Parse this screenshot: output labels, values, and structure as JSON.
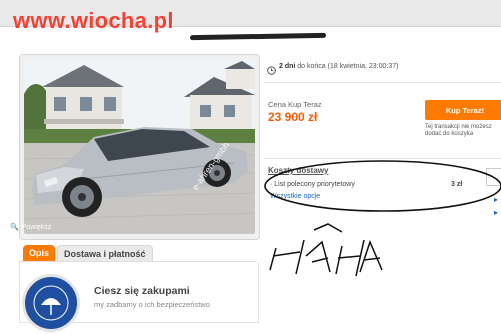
{
  "site": {
    "logo": "www.wiocha.pl"
  },
  "auction": {
    "deadline_prefix": "2 dni",
    "deadline_suffix": " do końca (18 kwietnia, 23:00:37)"
  },
  "gallery": {
    "zoom_label": "Powiększ",
    "watermark": "e-ahren-gmbh"
  },
  "price": {
    "label": "Cena Kup Teraz",
    "value": "23 900 zł",
    "buy_button": "Kup Teraz!",
    "basket_note": "Tej transakcji nie możesz dodać do koszyka"
  },
  "shipping": {
    "title": "Koszty dostawy",
    "method": "List polecony priorytetowy",
    "method_price": "3 zł",
    "all_options": "Wszystkie opcje"
  },
  "tabs": [
    {
      "label": "Opis"
    },
    {
      "label": "Dostawa i płatność"
    }
  ],
  "shop": {
    "title": "Ciesz się zakupami",
    "subtitle": "my zadbamy o ich bezpieczeństwo"
  },
  "annotation": {
    "handwritten": "HAHA"
  },
  "colors": {
    "accent": "#ff7a00",
    "price": "#ff5a00",
    "logo": "#ff3d2e",
    "link": "#1a66c0"
  }
}
